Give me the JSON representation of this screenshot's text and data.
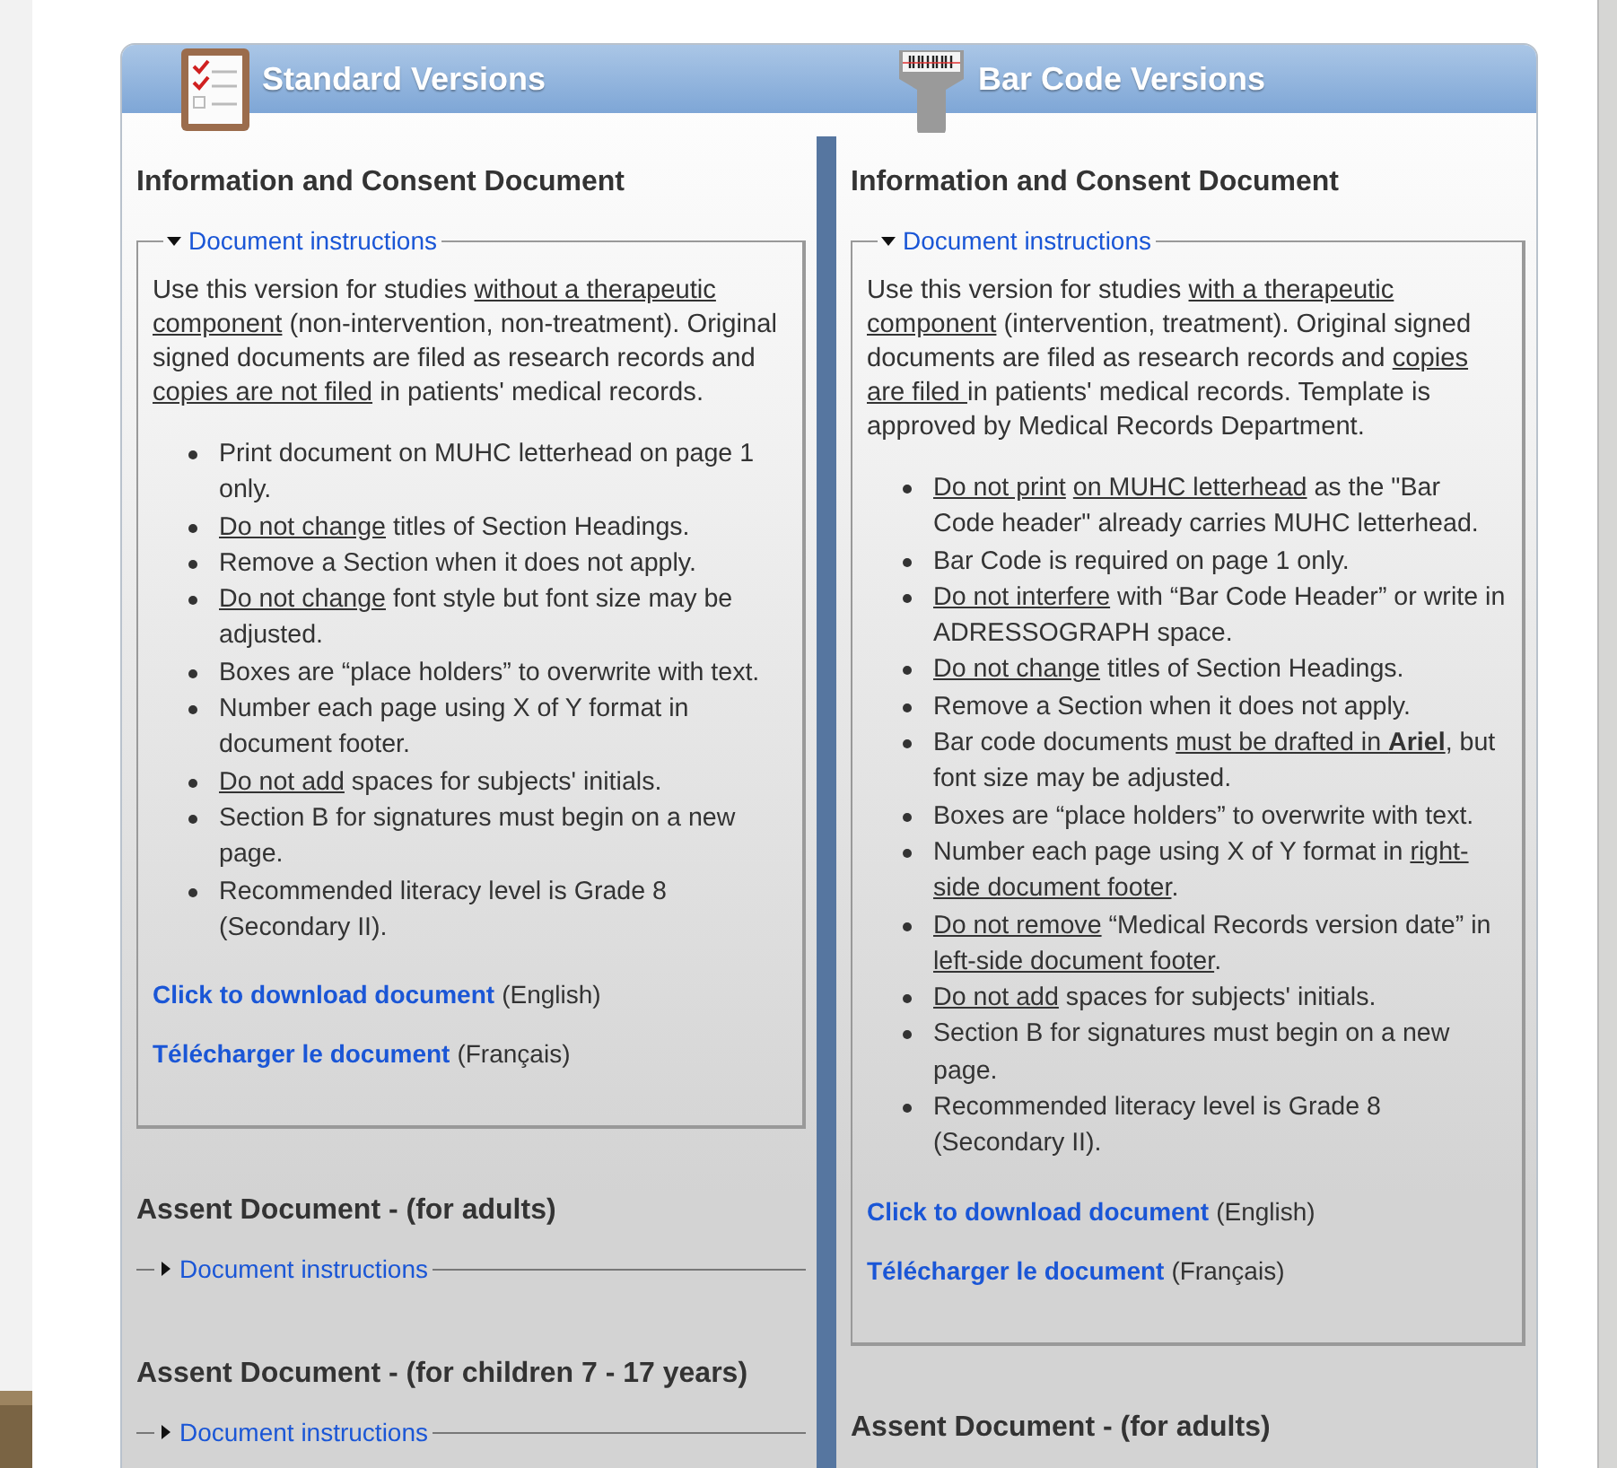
{
  "header": [
    {
      "title": "Standard Versions",
      "kind": "checklist"
    },
    {
      "title": "Bar Code Versions",
      "kind": "scanner"
    }
  ],
  "columns": [
    {
      "sections": [
        {
          "title": "Information and Consent Document",
          "instructions": {
            "label": "Document instructions",
            "expanded": true,
            "intro": [
              {
                "text": "Use this version for studies ",
                "underline": false
              },
              {
                "text": "without a therapeutic component",
                "underline": true
              },
              {
                "text": " (non-intervention, non-treatment). Original signed documents are filed as research records and ",
                "underline": false
              },
              {
                "text": "copies are not filed",
                "underline": true
              },
              {
                "text": " in patients' medical records.",
                "underline": false
              }
            ],
            "bullets": [
              [
                {
                  "text": "Print document on MUHC letterhead on page 1 only.",
                  "underline": false
                }
              ],
              [
                {
                  "text": "Do not change",
                  "underline": true
                },
                {
                  "text": " titles of Section Headings.",
                  "underline": false
                }
              ],
              [
                {
                  "text": "Remove a Section when it does not apply.",
                  "underline": false
                }
              ],
              [
                {
                  "text": "Do not change",
                  "underline": true
                },
                {
                  "text": " font style but font size may be adjusted.",
                  "underline": false
                }
              ],
              [
                {
                  "text": "Boxes are “place holders” to overwrite with text.",
                  "underline": false
                }
              ],
              [
                {
                  "text": "Number each page using X of Y format in document footer.",
                  "underline": false
                }
              ],
              [
                {
                  "text": "Do not add",
                  "underline": true
                },
                {
                  "text": " spaces for subjects' initials.",
                  "underline": false
                }
              ],
              [
                {
                  "text": "Section B for signatures must begin on a new page.",
                  "underline": false
                }
              ],
              [
                {
                  "text": "Recommended literacy level is Grade 8 (Secondary II).",
                  "underline": false
                }
              ]
            ],
            "links": [
              {
                "link": "Click to download document",
                "note": "(English)"
              },
              {
                "link": "Télécharger le document",
                "note": "(Français)"
              }
            ]
          }
        },
        {
          "title": "Assent Document - (for adults)",
          "instructions": {
            "label": "Document instructions",
            "expanded": false
          }
        },
        {
          "title": "Assent Document - (for children 7 - 17 years)",
          "instructions": {
            "label": "Document instructions",
            "expanded": false
          }
        }
      ]
    },
    {
      "sections": [
        {
          "title": "Information and Consent Document",
          "instructions": {
            "label": "Document instructions",
            "expanded": true,
            "intro": [
              {
                "text": "Use this version for studies ",
                "underline": false
              },
              {
                "text": "with a therapeutic component",
                "underline": true
              },
              {
                "text": " (intervention, treatment).  Original signed documents are filed as research records and ",
                "underline": false
              },
              {
                "text": "copies are filed ",
                "underline": true
              },
              {
                "text": "in patients' medical records.  Template is approved by Medical Records Department.",
                "underline": false
              }
            ],
            "bullets": [
              [
                {
                  "text": "Do not print",
                  "underline": true
                },
                {
                  "text": "on MUHC letterhead",
                  "underline": true
                },
                {
                  "text": " as the \"Bar Code header\" already carries MUHC letterhead.",
                  "underline": false
                }
              ],
              [
                {
                  "text": "Bar Code is required on page 1 only.",
                  "underline": false
                }
              ],
              [
                {
                  "text": "Do not interfere",
                  "underline": true
                },
                {
                  "text": " with “Bar Code Header” or write in ADRESSOGRAPH space.",
                  "underline": false
                }
              ],
              [
                {
                  "text": "Do not change",
                  "underline": true
                },
                {
                  "text": " titles of Section Headings.",
                  "underline": false
                }
              ],
              [
                {
                  "text": "Remove a Section when it does not apply.",
                  "underline": false
                }
              ],
              [
                {
                  "text": "Bar code documents ",
                  "underline": false
                },
                {
                  "text": "must be drafted in **Ariel**",
                  "underline": true
                },
                {
                  "text": ", but font size may be adjusted.",
                  "underline": false
                }
              ],
              [
                {
                  "text": "Boxes are “place holders” to overwrite with text.",
                  "underline": false
                }
              ],
              [
                {
                  "text": "Number each page using X of Y format in ",
                  "underline": false
                },
                {
                  "text": "right-side document footer",
                  "underline": true
                },
                {
                  "text": ".",
                  "underline": false
                }
              ],
              [
                {
                  "text": "Do not remove",
                  "underline": true
                },
                {
                  "text": " “Medical Records version date” in ",
                  "underline": false
                },
                {
                  "text": "left-side document footer",
                  "underline": true
                },
                {
                  "text": ".",
                  "underline": false
                }
              ],
              [
                {
                  "text": "Do not add",
                  "underline": true
                },
                {
                  "text": " spaces for subjects' initials.",
                  "underline": false
                }
              ],
              [
                {
                  "text": "Section B for signatures must begin on a new page.",
                  "underline": false
                }
              ],
              [
                {
                  "text": "Recommended literacy level is Grade 8 (Secondary II).",
                  "underline": false
                }
              ]
            ],
            "links": [
              {
                "link": "Click to download document",
                "note": "(English)"
              },
              {
                "link": "Télécharger le document",
                "note": "(Français)"
              }
            ]
          }
        },
        {
          "title": "Assent Document - (for adults)"
        }
      ]
    }
  ]
}
